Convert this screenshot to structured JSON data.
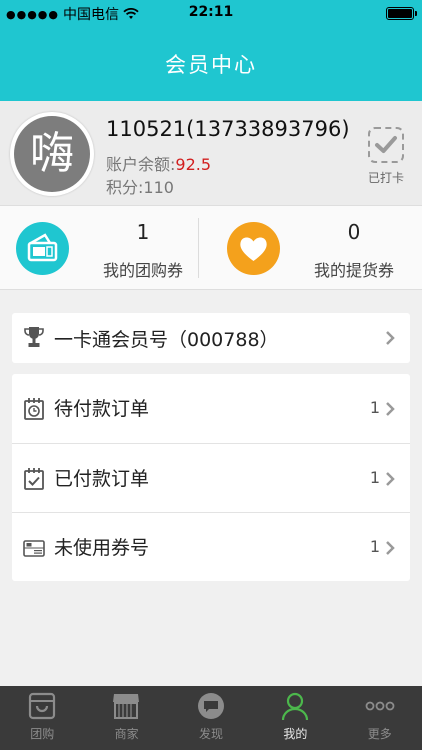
{
  "status_bar": {
    "signal_dots": "●●●●●",
    "carrier": "中国电信",
    "time": "22:11"
  },
  "header": {
    "title": "会员中心"
  },
  "profile": {
    "avatar_char": "嗨",
    "user_id": "110521(13733893796)",
    "balance_label": "账户余额:",
    "balance_value": "92.5",
    "points_label": "积分:",
    "points_value": "110",
    "checkin_label": "已打卡"
  },
  "coupons": [
    {
      "count": "1",
      "label": "我的团购券",
      "color": "#1fc6d0",
      "icon": "ticket-icon"
    },
    {
      "count": "0",
      "label": "我的提货券",
      "color": "#f4a11c",
      "icon": "heart-icon"
    }
  ],
  "card_membership": {
    "label": "一卡通会员号（000788）",
    "icon": "trophy-icon"
  },
  "orders": [
    {
      "label": "待付款订单",
      "count": "1",
      "icon": "calendar-clock-icon"
    },
    {
      "label": "已付款订单",
      "count": "1",
      "icon": "calendar-check-icon"
    },
    {
      "label": "未使用券号",
      "count": "1",
      "icon": "gift-card-icon"
    }
  ],
  "tabs": [
    {
      "label": "团购",
      "icon": "bag-icon",
      "active": false
    },
    {
      "label": "商家",
      "icon": "store-icon",
      "active": false
    },
    {
      "label": "发现",
      "icon": "chat-bubble-icon",
      "active": false
    },
    {
      "label": "我的",
      "icon": "person-icon",
      "active": true
    },
    {
      "label": "更多",
      "icon": "more-dots-icon",
      "active": false
    }
  ],
  "colors": {
    "accent": "#1fc6d0",
    "orange": "#f4a11c",
    "balance_red": "#d21f1f",
    "tab_active": "#4cb84c"
  }
}
